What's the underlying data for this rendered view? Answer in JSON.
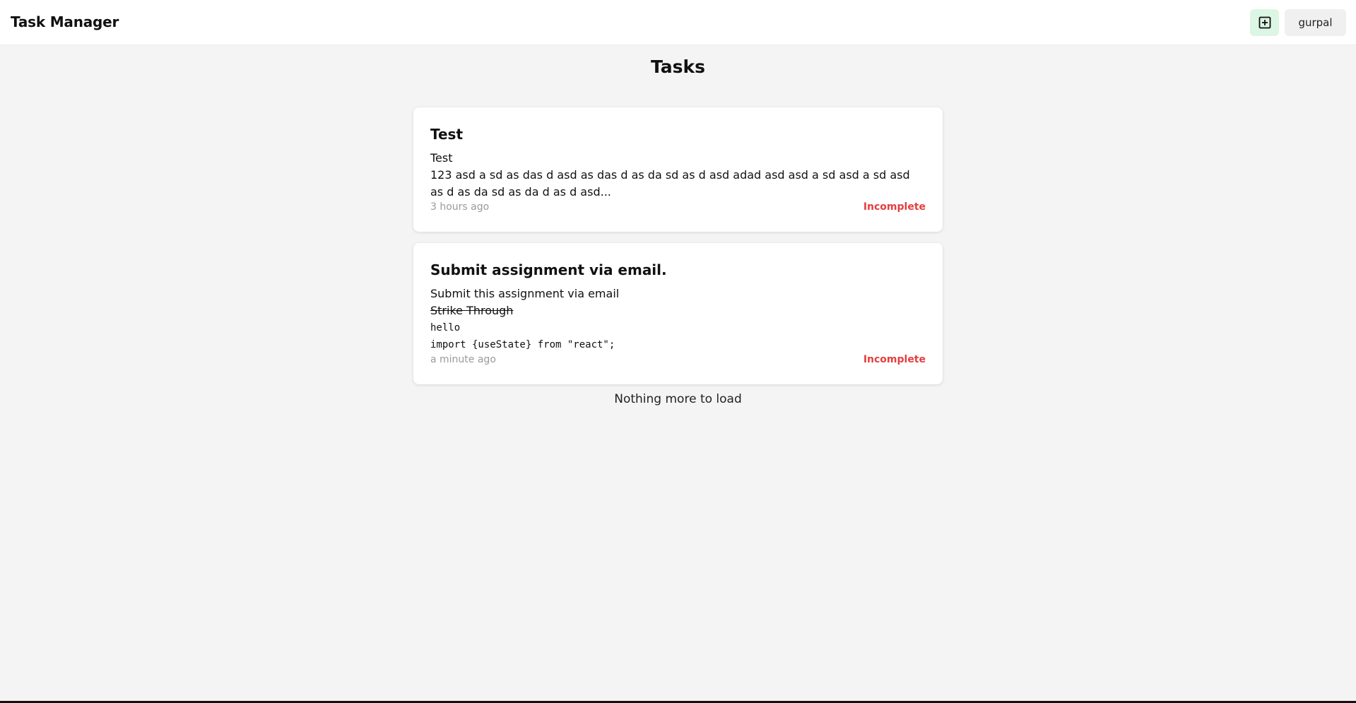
{
  "header": {
    "brand": "Task Manager",
    "add_icon": "plus-square-icon",
    "user_label": "gurpal",
    "accent_color": "#dcf6e4"
  },
  "main": {
    "title": "Tasks",
    "tasks": [
      {
        "title": "Test",
        "body_lines": [
          "Test",
          "123 asd a sd as das d asd as das d as da sd as d asd adad asd asd a sd asd a sd asd as d as da sd as da d as d asd..."
        ],
        "timestamp": "3 hours ago",
        "status": "Incomplete"
      },
      {
        "title": "Submit assignment via email.",
        "body_lines": [
          "Submit this assignment via email",
          "Strike Through",
          "hello",
          "import {useState} from \"react\";"
        ],
        "timestamp": "a minute ago",
        "status": "Incomplete"
      }
    ],
    "end_message": "Nothing more to load"
  },
  "colors": {
    "status_incomplete": "#e53e3e",
    "background": "#f4f4f4"
  }
}
